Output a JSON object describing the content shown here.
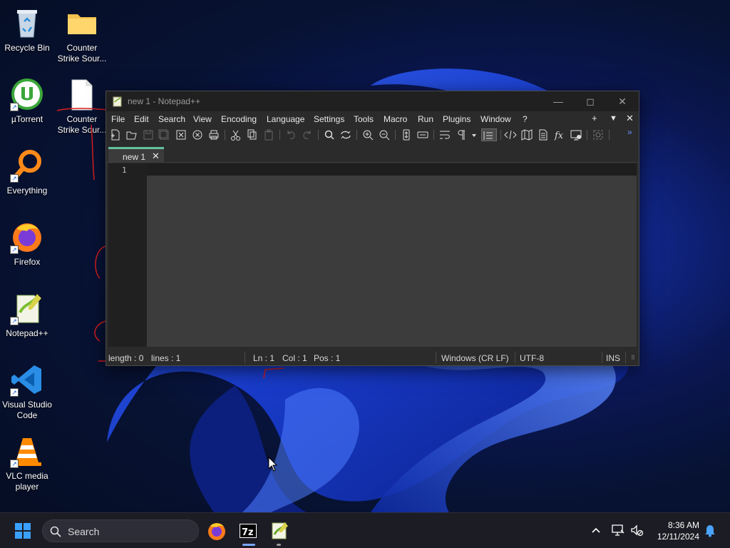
{
  "desktop": {
    "icons": [
      {
        "label": "Recycle Bin"
      },
      {
        "label": "Counter\nStrike Sour..."
      },
      {
        "label": "µTorrent"
      },
      {
        "label": "Counter\nStrike Sour..."
      },
      {
        "label": "Everything"
      },
      {
        "label": "Firefox"
      },
      {
        "label": "Notepad++"
      },
      {
        "label": "Visual Studio\nCode"
      },
      {
        "label": "VLC media\nplayer"
      }
    ]
  },
  "window": {
    "title": "new 1 - Notepad++",
    "menu": [
      "File",
      "Edit",
      "Search",
      "View",
      "Encoding",
      "Language",
      "Settings",
      "Tools",
      "Macro",
      "Run",
      "Plugins",
      "Window",
      "?"
    ],
    "menu_right": {
      "add": "+",
      "dropdown": "▼",
      "close": "✕"
    },
    "toolbar_overflow": "»",
    "tab": {
      "label": "new 1",
      "close": "✕"
    },
    "line_number": "1",
    "status": {
      "length": "length : 0",
      "lines": "lines : 1",
      "ln": "Ln : 1",
      "col": "Col : 1",
      "pos": "Pos : 1",
      "eol": "Windows (CR LF)",
      "encoding": "UTF-8",
      "mode": "INS"
    }
  },
  "taskbar": {
    "search_placeholder": "Search",
    "time": "8:36 AM",
    "date": "12/11/2024",
    "icons": [
      "windows-start-icon",
      "firefox-icon",
      "7zip-icon",
      "notepadpp-icon",
      "chevron-up-icon",
      "network-icon",
      "volume-muted-icon",
      "notification-bell-icon"
    ]
  },
  "colors": {
    "accent_tab": "#63c19d",
    "taskbar_bg": "#1c1c24",
    "editor_bg": "#3c3c3c",
    "window_bg": "#2b2b2b"
  }
}
